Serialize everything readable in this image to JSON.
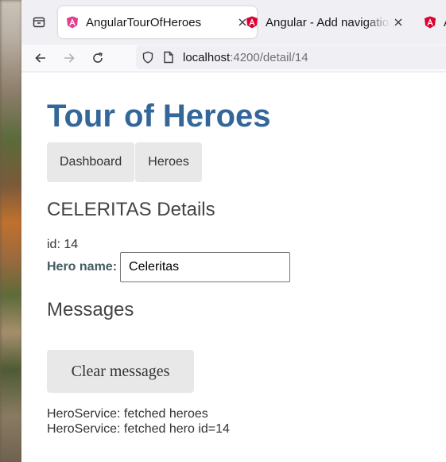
{
  "browser": {
    "tabs": [
      {
        "title": "AngularTourOfHeroes",
        "active": true,
        "favicon": "angular-pink-icon"
      },
      {
        "title": "Angular - Add navigation",
        "active": false,
        "favicon": "angular-red-icon"
      },
      {
        "title": "A",
        "active": false,
        "favicon": "angular-red-icon"
      }
    ],
    "url_host": "localhost",
    "url_rest": ":4200/detail/14"
  },
  "app": {
    "title": "Tour of Heroes",
    "nav": [
      "Dashboard",
      "Heroes"
    ],
    "hero_details_title": "CELERITAS Details",
    "hero_id_text": "id: 14",
    "hero_name_label": "Hero name:",
    "hero_name_value": "Celeritas",
    "messages_title": "Messages",
    "clear_button_label": "Clear messages",
    "messages": [
      "HeroService: fetched heroes",
      "HeroService: fetched hero id=14"
    ]
  },
  "colors": {
    "title": "#336699",
    "nav_bg": "#e8e8e8",
    "accent_angular_pink": "#e23c8f",
    "accent_angular_red": "#dd0031"
  }
}
